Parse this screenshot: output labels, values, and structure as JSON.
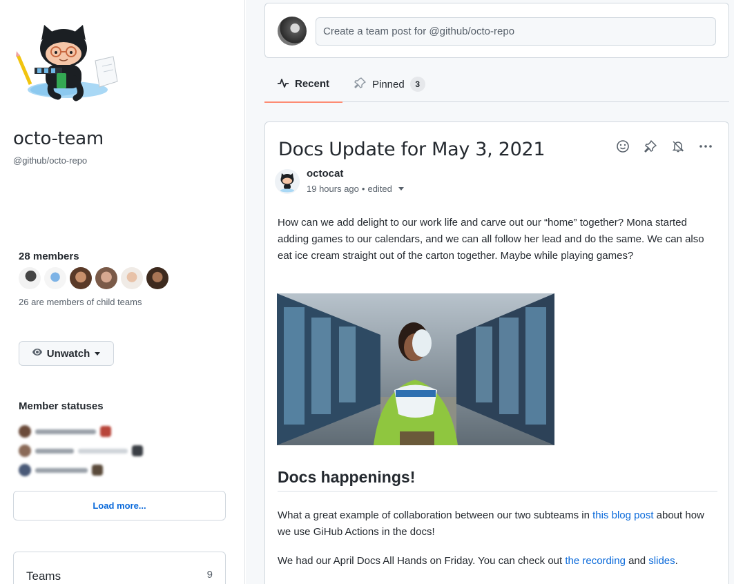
{
  "sidebar": {
    "team_name": "octo-team",
    "team_handle": "@github/octo-repo",
    "members_title": "28 members",
    "child_teams_note": "26 are members of child teams",
    "unwatch_label": "Unwatch",
    "member_statuses_title": "Member statuses",
    "load_more_label": "Load more...",
    "teams_label": "Teams",
    "teams_count": "9"
  },
  "compose": {
    "placeholder": "Create a team post for @github/octo-repo"
  },
  "tabs": [
    {
      "label": "Recent",
      "icon": "pulse-icon",
      "active": true
    },
    {
      "label": "Pinned",
      "icon": "pin-icon",
      "count": "3"
    }
  ],
  "post": {
    "title": "Docs Update for May 3, 2021",
    "author": "octocat",
    "timestamp": "19 hours ago",
    "separator": "•",
    "edited": "edited",
    "body": "How can we add delight to our work life and carve out our “home” together? Mona started adding games to our calendars, and we can all follow her lead and do the same. We can also eat ice cream straight out of the carton together. Maybe while playing games?",
    "heading": "Docs happenings!",
    "p2": {
      "before": "What a great example of collaboration between our two subteams in ",
      "link": "this blog post",
      "after": " about how we use GiHub Actions in the docs!"
    },
    "p3": {
      "before": "We had our April Docs All Hands on Friday. You can check out ",
      "link1": "the recording",
      "middle": " and ",
      "link2": "slides",
      "after": "."
    },
    "actions": [
      "smiley-icon",
      "pin-icon",
      "bell-slash-icon",
      "kebab-horizontal-icon"
    ]
  },
  "colors": {
    "accent_link": "#0969da",
    "tab_underline": "#fd8c73",
    "border": "#d0d7de"
  }
}
